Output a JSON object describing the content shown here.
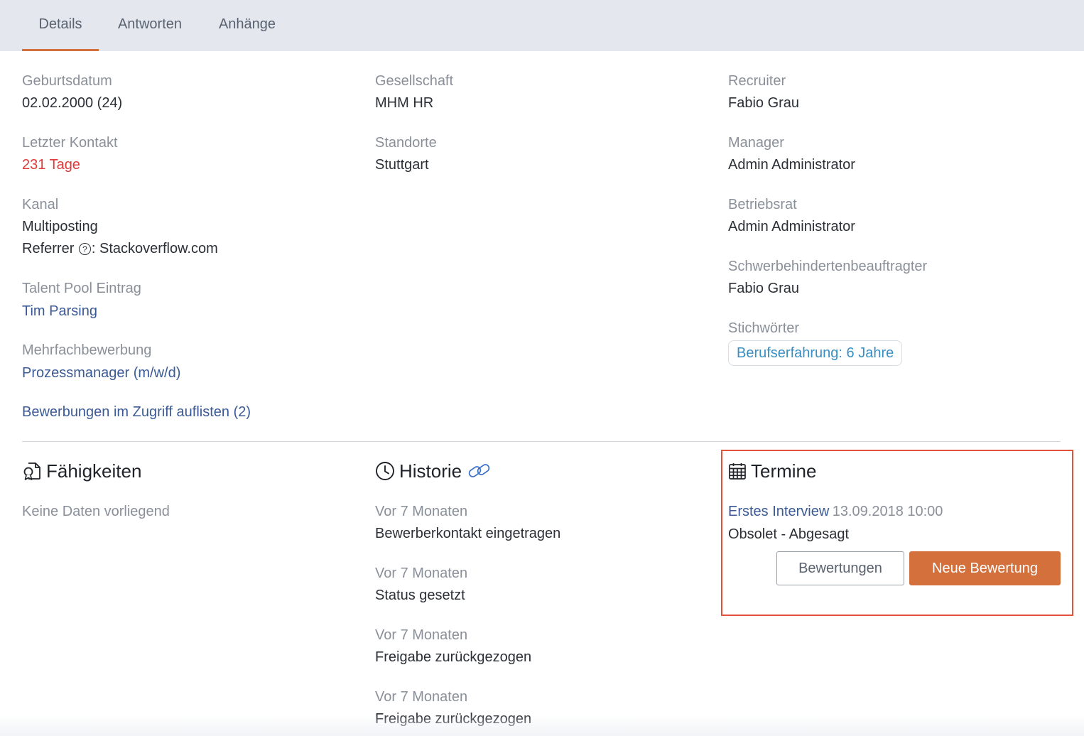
{
  "tabs": [
    {
      "label": "Details",
      "active": true
    },
    {
      "label": "Antworten",
      "active": false
    },
    {
      "label": "Anhänge",
      "active": false
    }
  ],
  "details": {
    "geburtsdatum": {
      "label": "Geburtsdatum",
      "value": "02.02.2000 (24)"
    },
    "letzter_kontakt": {
      "label": "Letzter Kontakt",
      "value": "231 Tage"
    },
    "kanal": {
      "label": "Kanal",
      "value": "Multiposting",
      "referrer_label": "Referrer",
      "referrer_icon": "?",
      "referrer_value": ": Stackoverflow.com"
    },
    "talent_pool": {
      "label": "Talent Pool Eintrag",
      "value": "Tim Parsing"
    },
    "mehrfachbewerbung": {
      "label": "Mehrfachbewerbung",
      "value": "Prozessmanager (m/w/d)"
    },
    "bewerbungen_link": "Bewerbungen im Zugriff auflisten (2)",
    "gesellschaft": {
      "label": "Gesellschaft",
      "value": "MHM HR"
    },
    "standorte": {
      "label": "Standorte",
      "value": "Stuttgart"
    },
    "recruiter": {
      "label": "Recruiter",
      "value": "Fabio Grau"
    },
    "manager": {
      "label": "Manager",
      "value": "Admin Administrator"
    },
    "betriebsrat": {
      "label": "Betriebsrat",
      "value": "Admin Administrator"
    },
    "schwerbehinderten": {
      "label": "Schwerbehindertenbeauftragter",
      "value": "Fabio Grau"
    },
    "stichwoerter": {
      "label": "Stichwörter",
      "tags": [
        "Berufserfahrung: 6 Jahre"
      ]
    }
  },
  "faehigkeiten": {
    "title": "Fähigkeiten",
    "empty": "Keine Daten vorliegend"
  },
  "historie": {
    "title": "Historie",
    "items": [
      {
        "time": "Vor 7 Monaten",
        "text": "Bewerberkontakt eingetragen"
      },
      {
        "time": "Vor 7 Monaten",
        "text": "Status gesetzt"
      },
      {
        "time": "Vor 7 Monaten",
        "text": "Freigabe zurückgezogen"
      },
      {
        "time": "Vor 7 Monaten",
        "text": "Freigabe zurückgezogen"
      }
    ]
  },
  "termine": {
    "title": "Termine",
    "event_name": "Erstes Interview",
    "event_date": "13.09.2018 10:00",
    "status": "Obsolet - Abgesagt",
    "btn_bewertungen": "Bewertungen",
    "btn_neue": "Neue Bewertung"
  },
  "colors": {
    "accent": "#d4703c",
    "link": "#3b5a95",
    "alert": "#e0393a",
    "highlight_border": "#e2533a"
  }
}
